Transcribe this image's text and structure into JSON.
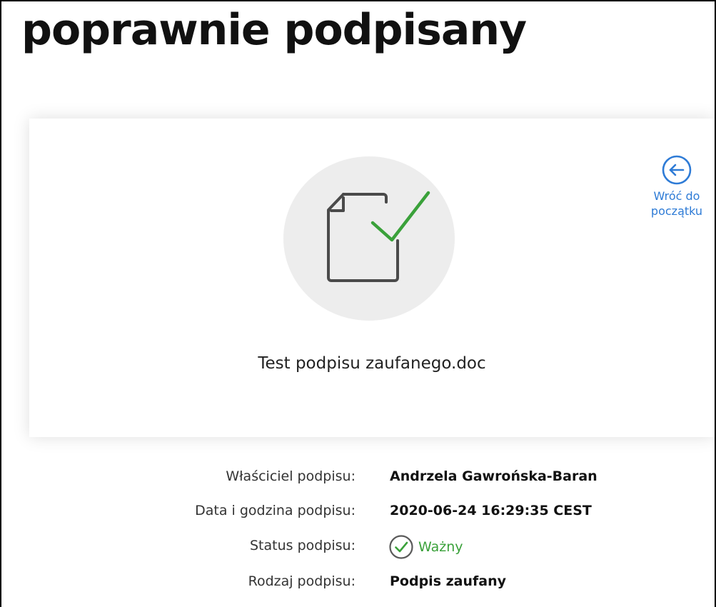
{
  "page": {
    "title": "poprawnie podpisany"
  },
  "card": {
    "back_link_label_line1": "Wróć do",
    "back_link_label_line2": "początku",
    "file_name": "Test podpisu zaufanego.doc",
    "icons": {
      "back": "arrow-left-circle-icon",
      "document": "document-check-icon"
    }
  },
  "details": {
    "owner_label": "Właściciel podpisu:",
    "owner_value": "Andrzela Gawrońska-Baran",
    "date_label": "Data i godzina podpisu:",
    "date_value": "2020-06-24 16:29:35 CEST",
    "status_label": "Status podpisu:",
    "status_value": "Ważny",
    "type_label": "Rodzaj podpisu:",
    "type_value": "Podpis zaufany",
    "status_icon": "check-circle-icon"
  },
  "colors": {
    "accent_blue": "#2e7bd6",
    "success_green": "#3aa13a",
    "icon_gray": "#4a4a4a",
    "circle_bg": "#ededed"
  }
}
